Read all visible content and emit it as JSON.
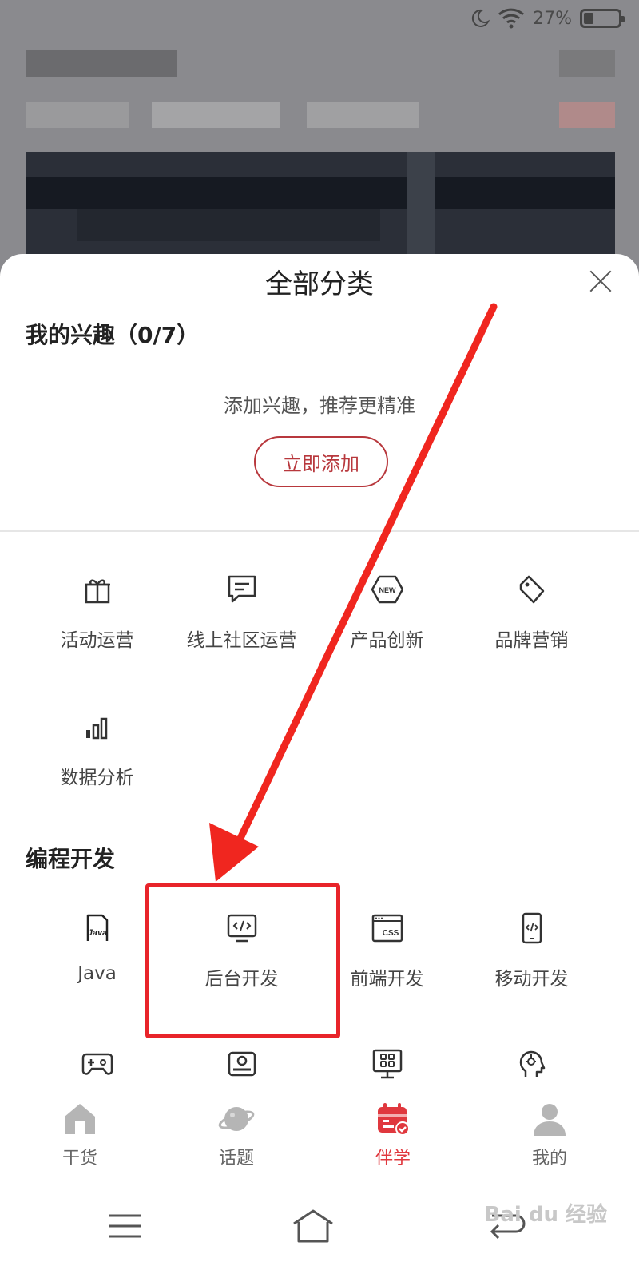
{
  "status": {
    "battery": "27%"
  },
  "sheet": {
    "title": "全部分类",
    "interests": {
      "heading": "我的兴趣（0/7）",
      "hint": "添加兴趣，推荐更精准",
      "add_button": "立即添加"
    },
    "categories": [
      {
        "label": "活动运营",
        "icon": "gift-icon"
      },
      {
        "label": "线上社区运营",
        "icon": "chat-icon"
      },
      {
        "label": "产品创新",
        "icon": "new-badge-icon",
        "icon_text": "NEW"
      },
      {
        "label": "品牌营销",
        "icon": "tag-icon"
      },
      {
        "label": "数据分析",
        "icon": "bar-chart-icon"
      }
    ],
    "programming": {
      "heading": "编程开发",
      "items": [
        {
          "label": "Java",
          "icon": "java-file-icon",
          "icon_text": "Java"
        },
        {
          "label": "后台开发",
          "icon": "code-monitor-icon"
        },
        {
          "label": "前端开发",
          "icon": "css-window-icon",
          "icon_text": "CSS"
        },
        {
          "label": "移动开发",
          "icon": "phone-code-icon"
        }
      ],
      "more_icons": [
        "gamepad-icon",
        "card-reader-icon",
        "board-icon",
        "ai-head-icon"
      ]
    }
  },
  "tabbar": {
    "tabs": [
      {
        "label": "干货",
        "icon": "home-icon",
        "active": false
      },
      {
        "label": "话题",
        "icon": "planet-icon",
        "active": false
      },
      {
        "label": "伴学",
        "icon": "calendar-check-icon",
        "active": true
      },
      {
        "label": "我的",
        "icon": "user-icon",
        "active": false
      }
    ]
  },
  "colors": {
    "accent": "#e0383e",
    "button_border": "#b8383d",
    "highlight": "#e8242a"
  },
  "watermark": "Bai du 经验"
}
